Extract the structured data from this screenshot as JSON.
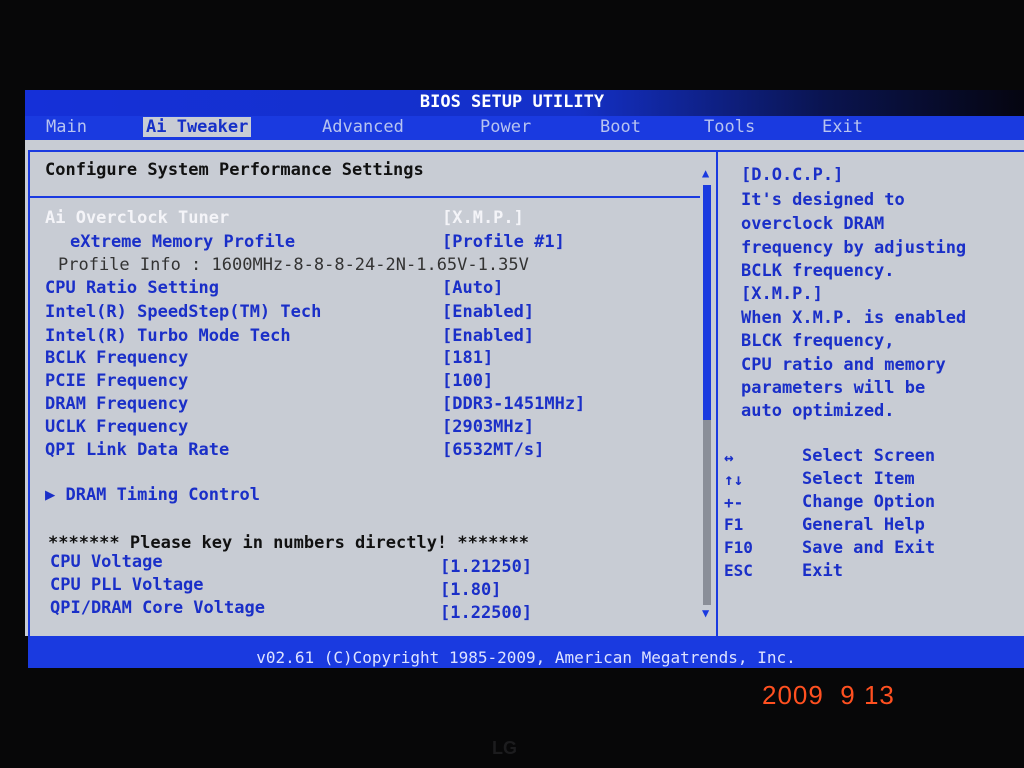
{
  "title": "BIOS SETUP UTILITY",
  "tabs": [
    "Main",
    "Ai Tweaker",
    "Advanced",
    "Power",
    "Boot",
    "Tools",
    "Exit"
  ],
  "active_tab": "Ai Tweaker",
  "heading": "Configure System Performance Settings",
  "settings": [
    {
      "label": "Ai Overclock Tuner",
      "value": "[X.M.P.]"
    },
    {
      "label": "eXtreme Memory Profile",
      "value": "[Profile #1]"
    },
    {
      "label": "Profile Info : 1600MHz-8-8-8-24-2N-1.65V-1.35V"
    },
    {
      "label": "CPU Ratio Setting",
      "value": "[Auto]"
    },
    {
      "label": "Intel(R) SpeedStep(TM) Tech",
      "value": "[Enabled]"
    },
    {
      "label": "Intel(R) Turbo Mode Tech",
      "value": "[Enabled]"
    },
    {
      "label": "BCLK Frequency",
      "value": "[181]"
    },
    {
      "label": "PCIE Frequency",
      "value": "[100]"
    },
    {
      "label": "DRAM Frequency",
      "value": "[DDR3-1451MHz]"
    },
    {
      "label": "UCLK Frequency",
      "value": "[2903MHz]"
    },
    {
      "label": "QPI Link Data Rate",
      "value": "[6532MT/s]"
    }
  ],
  "submenu": "▶ DRAM Timing Control",
  "notice": "******* Please key in numbers directly! *******",
  "voltages": [
    {
      "label": "CPU Voltage",
      "value": "[1.21250]"
    },
    {
      "label": "CPU PLL Voltage",
      "value": "[1.80]"
    },
    {
      "label": "QPI/DRAM Core Voltage",
      "value": "[1.22500]"
    }
  ],
  "help_lines": [
    "[D.O.C.P.]",
    "It's designed to",
    "overclock DRAM",
    "frequency by adjusting",
    "BCLK frequency.",
    "[X.M.P.]",
    "When X.M.P. is enabled",
    "BLCK frequency,",
    "CPU ratio and memory",
    "parameters will be",
    "auto optimized."
  ],
  "keys": [
    {
      "key": "↔",
      "desc": "Select Screen"
    },
    {
      "key": "↑↓",
      "desc": "Select Item"
    },
    {
      "key": "+-",
      "desc": "Change Option"
    },
    {
      "key": "F1",
      "desc": "General Help"
    },
    {
      "key": "F10",
      "desc": "Save and Exit"
    },
    {
      "key": "ESC",
      "desc": "Exit"
    }
  ],
  "footer": "v02.61 (C)Copyright 1985-2009, American Megatrends, Inc.",
  "date_stamp": "2009  9 13",
  "monitor_logo": "LG"
}
